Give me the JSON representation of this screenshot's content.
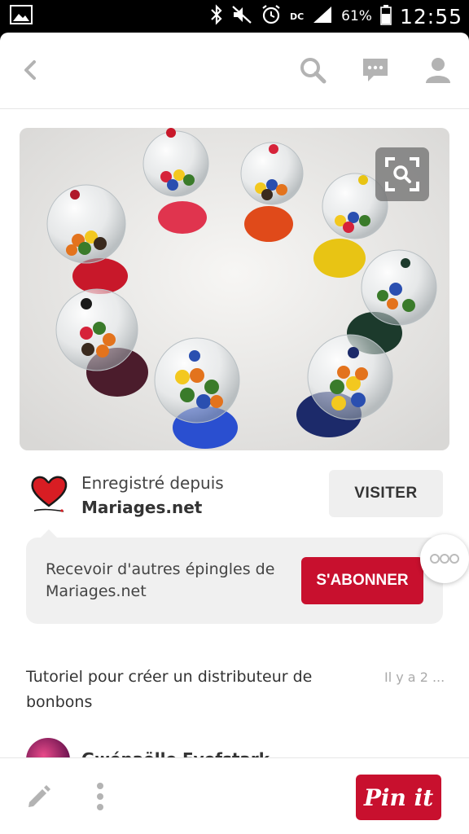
{
  "status_bar": {
    "battery_percent": "61%",
    "time": "12:55",
    "network": "DC"
  },
  "source": {
    "saved_from_label": "Enregistré depuis",
    "site_name": "Mariages.net",
    "visit_label": "VISITER"
  },
  "subscribe": {
    "text": "Recevoir d'autres épingles de Mariages.net",
    "button_label": "S'ABONNER"
  },
  "pin": {
    "description": "Tutoriel pour créer un distributeur de bonbons",
    "time_ago": "Il y a 2 ...",
    "pinner_name": "Gwénaëlle Eyefstark"
  },
  "bottom_bar": {
    "pinit_label": "Pin it"
  },
  "colors": {
    "accent_red": "#c8102e",
    "card_grey": "#f0f0f0",
    "icon_grey": "#b3b3b3"
  }
}
